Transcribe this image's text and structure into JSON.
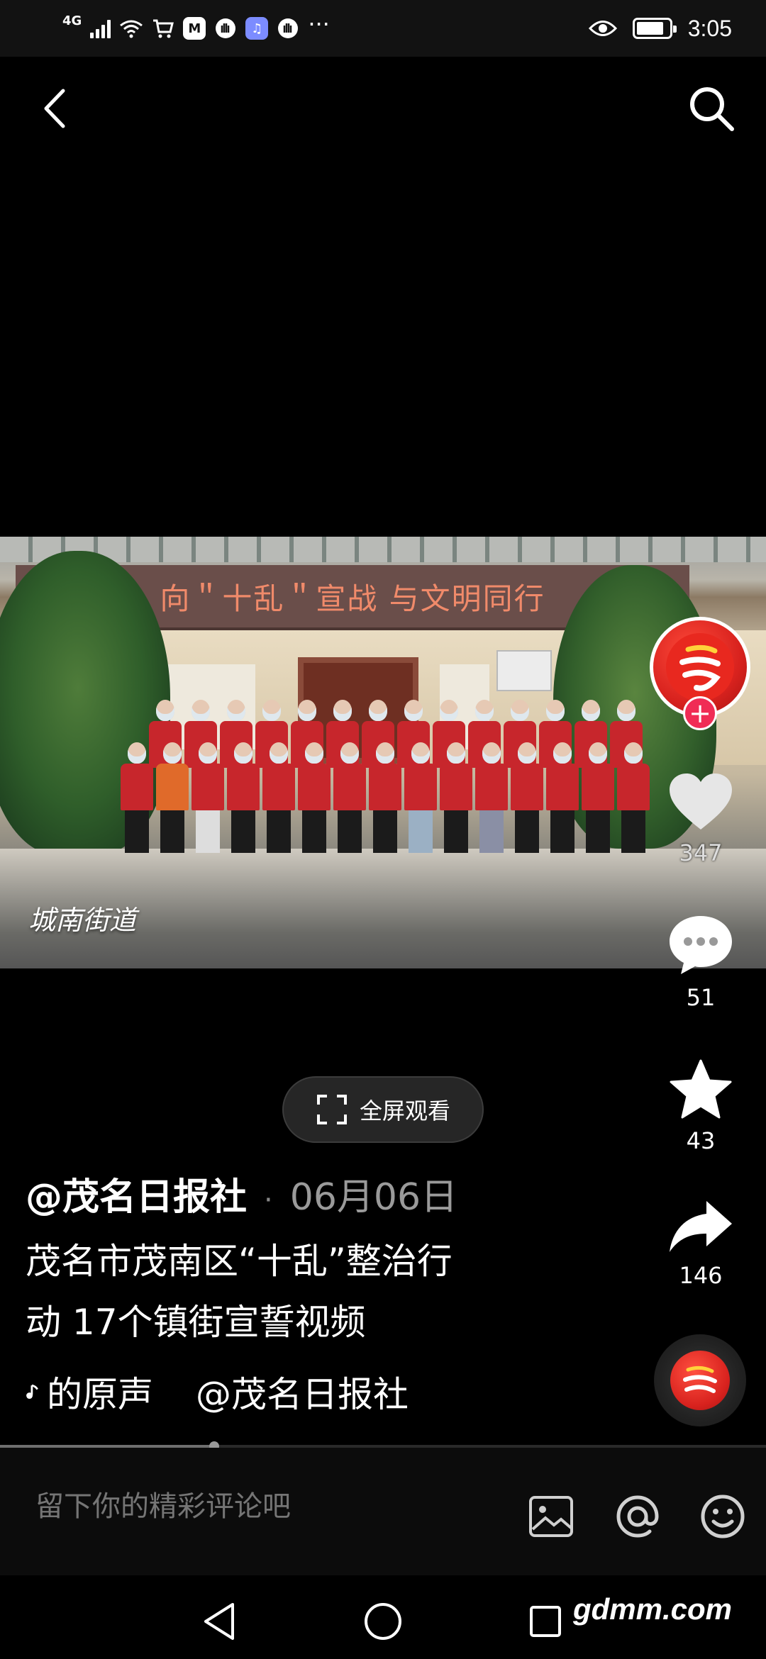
{
  "status_bar": {
    "network": "4G",
    "time": "3:05",
    "battery_level": 0.85
  },
  "video": {
    "banner_text": "向＂十乱＂宣战 与文明同行",
    "watermark": "城南街道"
  },
  "actions": {
    "likes": "347",
    "comments": "51",
    "favorites": "43",
    "shares": "146"
  },
  "fullscreen_label": "全屏观看",
  "caption": {
    "author": "@茂名日报社",
    "separator": "·",
    "date": "06月06日",
    "description_line1": "茂名市茂南区“十乱”整治行",
    "description_line2": "动 17个镇街宣誓视频",
    "music_text": "的原声",
    "music_author": "@茂名日报社"
  },
  "progress": {
    "fraction": 0.28
  },
  "comment_bar": {
    "placeholder": "留下你的精彩评论吧"
  },
  "watermark_site": "gdmm.com",
  "icons": {
    "back": "back-arrow-icon",
    "search": "search-icon",
    "like": "heart-icon",
    "comment": "comment-bubble-icon",
    "favorite": "star-icon",
    "share": "share-arrow-icon",
    "image": "image-icon",
    "mention": "at-icon",
    "emoji": "emoji-icon"
  },
  "colors": {
    "follow_plus": "#f02c55",
    "avatar_red": "#d8221e"
  }
}
